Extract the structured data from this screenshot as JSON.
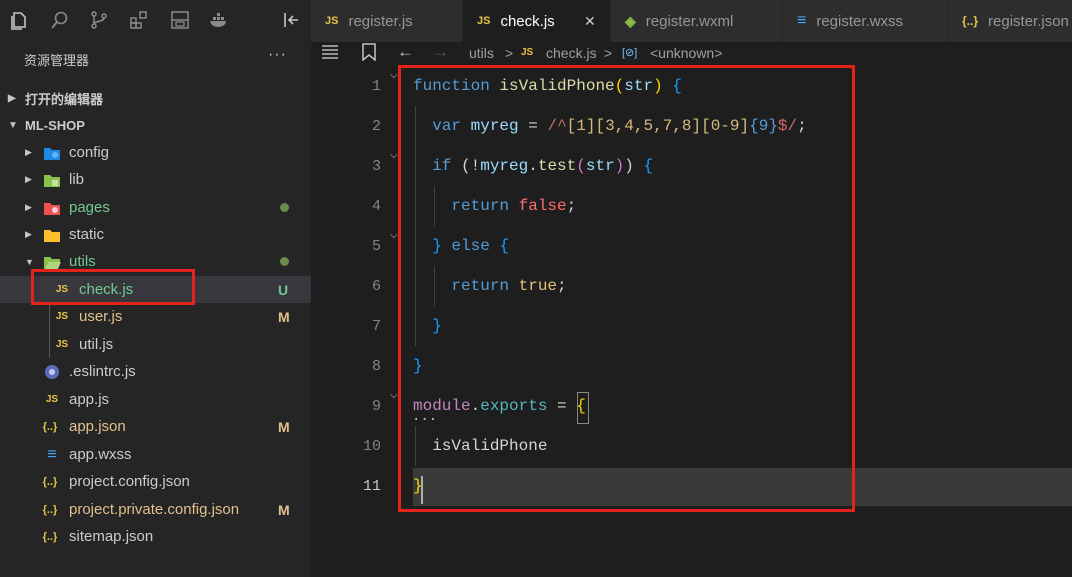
{
  "colors": {
    "accent_red": "#e4231d",
    "js_icon": "#e8c547",
    "json_icon": "#e8c547",
    "css_icon": "#42a5f5",
    "git_modified": "#e2c08d",
    "git_untracked": "#73c991",
    "folder_green": "#8bc34a"
  },
  "activity_bar": [
    "files-icon",
    "search-icon",
    "source-control-icon",
    "extensions-icon",
    "remote-explorer-icon",
    "docker-icon",
    "collapse-panel-icon"
  ],
  "sidebar": {
    "title": "资源管理器",
    "more": "···",
    "open_editors": "打开的编辑器",
    "project": "ML-SHOP",
    "tree": [
      {
        "label": "config",
        "type": "folder",
        "icon": "gear-folder-icon"
      },
      {
        "label": "lib",
        "type": "folder",
        "icon": "lib-folder-icon"
      },
      {
        "label": "pages",
        "type": "folder",
        "icon": "pages-folder-icon",
        "git": "dot"
      },
      {
        "label": "static",
        "type": "folder",
        "icon": "folder-icon"
      },
      {
        "label": "utils",
        "type": "folder",
        "icon": "folder-open-icon",
        "git": "dot"
      },
      {
        "label": "check.js",
        "type": "file",
        "icon": "js-file-icon",
        "badge": "U"
      },
      {
        "label": "user.js",
        "type": "file",
        "icon": "js-file-icon",
        "badge": "M"
      },
      {
        "label": "util.js",
        "type": "file",
        "icon": "js-file-icon"
      },
      {
        "label": ".eslintrc.js",
        "type": "file",
        "icon": "eslint-file-icon"
      },
      {
        "label": "app.js",
        "type": "file",
        "icon": "js-file-icon"
      },
      {
        "label": "app.json",
        "type": "file",
        "icon": "json-file-icon",
        "badge": "M"
      },
      {
        "label": "app.wxss",
        "type": "file",
        "icon": "css-file-icon"
      },
      {
        "label": "project.config.json",
        "type": "file",
        "icon": "json-file-icon"
      },
      {
        "label": "project.private.config.json",
        "type": "file",
        "icon": "json-file-icon",
        "badge": "M"
      },
      {
        "label": "sitemap.json",
        "type": "file",
        "icon": "json-file-icon"
      }
    ],
    "icon_text": {
      "js": "JS",
      "json": "{..}",
      "css": "≡"
    }
  },
  "tabs": [
    {
      "label": "register.js",
      "icon": "JS"
    },
    {
      "label": "check.js",
      "icon": "JS",
      "active": true,
      "close": "✕"
    },
    {
      "label": "register.wxml",
      "icon": "◈"
    },
    {
      "label": "register.wxss",
      "icon": "≡"
    },
    {
      "label": "register.json",
      "icon": "{..}"
    }
  ],
  "breadcrumb": {
    "folder": "utils",
    "sep": ">",
    "file_icon": "JS",
    "file": "check.js",
    "symbol_icon": "[⊘]",
    "symbol": "<unknown>"
  },
  "editor": {
    "line_numbers": [
      "1",
      "2",
      "3",
      "4",
      "5",
      "6",
      "7",
      "8",
      "9",
      "10",
      "11"
    ],
    "lines": [
      "function isValidPhone(str) {",
      "  var myreg = /^[1][3,4,5,7,8][0-9]{9}$/;",
      "  if (!myreg.test(str)) {",
      "    return false;",
      "  } else {",
      "    return true;",
      "  }",
      "}",
      "module.exports = {",
      "  isValidPhone",
      "}"
    ],
    "current_line": 11
  }
}
